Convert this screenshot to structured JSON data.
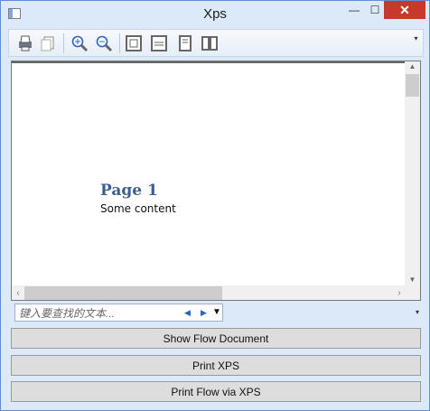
{
  "window": {
    "title": "Xps",
    "controls": [
      "—",
      "☐",
      "✕"
    ]
  },
  "toolbar": {
    "items": [
      "print-icon",
      "copy-icon",
      "zoom-in-icon",
      "zoom-out-icon",
      "actual-size-icon",
      "fit-width-icon",
      "whole-page-icon",
      "two-pages-icon"
    ]
  },
  "document": {
    "heading": "Page 1",
    "body": "Some content"
  },
  "find": {
    "placeholder": "键入要查找的文本..."
  },
  "buttons": {
    "show_flow": "Show Flow Document",
    "print_xps": "Print XPS",
    "print_flow": "Print Flow via XPS"
  }
}
